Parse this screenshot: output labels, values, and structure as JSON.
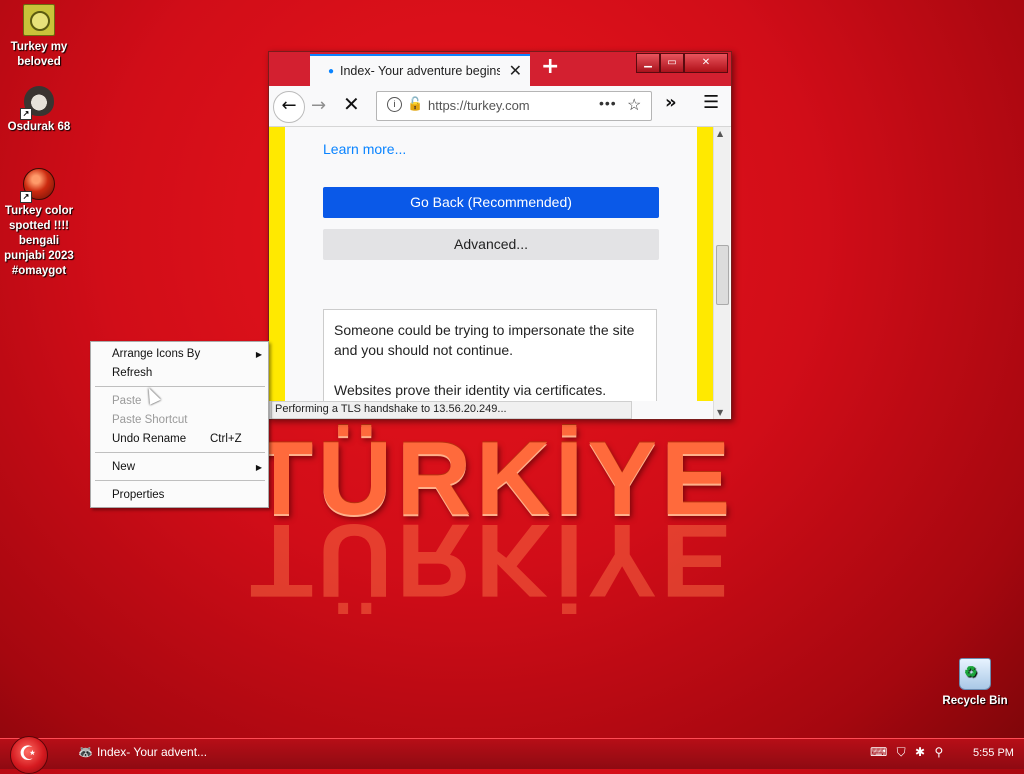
{
  "desktop": {
    "icons": [
      {
        "label": "Turkey my beloved",
        "icon": "document-icon"
      },
      {
        "label": "Osdurak 68",
        "icon": "raccoon-icon"
      },
      {
        "label": "Turkey color spotted !!!! bengali punjabi 2023 #omaygot",
        "icon": "ball-icon"
      },
      {
        "label": "Recycle Bin",
        "icon": "recycle-bin-icon"
      }
    ],
    "wallpaper_text": "TÜRKİYE"
  },
  "browser": {
    "tab_title": "Index- Your adventure begins h",
    "new_tab": "+",
    "url": "https://turkey.com",
    "learn_more": "Learn more...",
    "go_back_button": "Go Back (Recommended)",
    "advanced_button": "Advanced...",
    "warning_line1": "Someone could be trying to impersonate the site and you should not continue.",
    "warning_line2": "Websites prove their identity via certificates.",
    "status": "Performing a TLS handshake to 13.56.20.249..."
  },
  "context_menu": {
    "items": [
      {
        "label": "Arrange Icons By",
        "submenu": true
      },
      {
        "label": "Refresh"
      },
      {
        "label": "Paste",
        "disabled": true
      },
      {
        "label": "Paste Shortcut",
        "disabled": true
      },
      {
        "label": "Undo Rename",
        "shortcut": "Ctrl+Z"
      },
      {
        "label": "New",
        "submenu": true
      },
      {
        "label": "Properties"
      }
    ]
  },
  "taskbar": {
    "task": "Index- Your advent...",
    "clock": "5:55 PM"
  },
  "colors": {
    "accent": "#0a59e8",
    "brand_red": "#d10d18",
    "warning_yellow": "#ffe900"
  }
}
